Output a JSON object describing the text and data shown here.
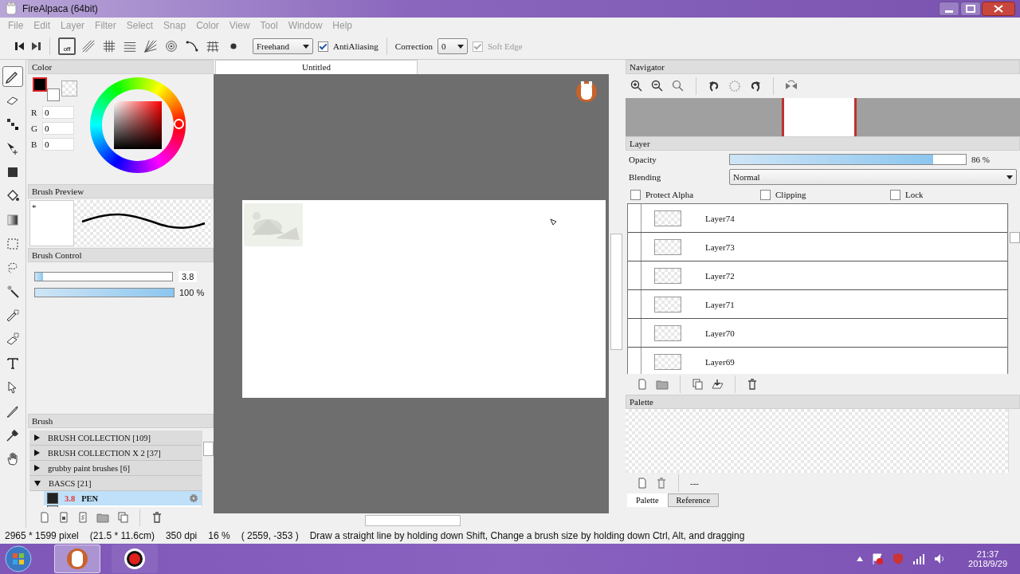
{
  "window": {
    "title": "FireAlpaca (64bit)"
  },
  "menu": [
    "File",
    "Edit",
    "Layer",
    "Filter",
    "Select",
    "Snap",
    "Color",
    "View",
    "Tool",
    "Window",
    "Help"
  ],
  "toolbar": {
    "snap_modes": [
      {
        "kind": "off",
        "label": "off",
        "selected": true
      },
      {
        "kind": "parallel",
        "selected": false
      },
      {
        "kind": "grid",
        "selected": false
      },
      {
        "kind": "horizontal",
        "selected": false
      },
      {
        "kind": "radial",
        "selected": false
      },
      {
        "kind": "circle",
        "selected": false
      },
      {
        "kind": "curve",
        "selected": false
      },
      {
        "kind": "perspective",
        "selected": false
      },
      {
        "kind": "dot",
        "selected": false
      }
    ],
    "stroke_mode": "Freehand",
    "antialiasing": {
      "label": "AntiAliasing",
      "checked": true
    },
    "correction": {
      "label": "Correction",
      "value": "0"
    },
    "soft_edge": {
      "label": "Soft Edge",
      "checked": true,
      "disabled": true
    }
  },
  "tools": [
    {
      "kind": "pen",
      "selected": true
    },
    {
      "kind": "eraser",
      "selected": false
    },
    {
      "kind": "dot",
      "selected": false
    },
    {
      "kind": "move",
      "selected": false
    },
    {
      "kind": "fill",
      "selected": false
    },
    {
      "kind": "bucket",
      "selected": false
    },
    {
      "kind": "gradient",
      "selected": false
    },
    {
      "kind": "select",
      "selected": false
    },
    {
      "kind": "lasso",
      "selected": false
    },
    {
      "kind": "wand",
      "selected": false
    },
    {
      "kind": "selpen",
      "selected": false
    },
    {
      "kind": "seleraser",
      "selected": false
    },
    {
      "kind": "text",
      "selected": false
    },
    {
      "kind": "operation",
      "selected": false
    },
    {
      "kind": "knife",
      "selected": false
    },
    {
      "kind": "dropper",
      "selected": false
    },
    {
      "kind": "hand",
      "selected": false
    }
  ],
  "color_panel": {
    "title": "Color",
    "channels": [
      {
        "label": "R",
        "value": "0"
      },
      {
        "label": "G",
        "value": "0"
      },
      {
        "label": "B",
        "value": "0"
      }
    ]
  },
  "brush_preview": {
    "title": "Brush Preview",
    "mark": "*"
  },
  "brush_control": {
    "title": "Brush Control",
    "size": {
      "level": 0.06,
      "reading": "3.8"
    },
    "opacity": {
      "level": 1,
      "reading": "100 %"
    }
  },
  "brush": {
    "title": "Brush",
    "groups": [
      {
        "label": "BRUSH COLLECTION [109]",
        "expanded": false
      },
      {
        "label": "BRUSH COLLECTION X 2 [37]",
        "expanded": false
      },
      {
        "label": "grubby paint brushes  [6]",
        "expanded": false
      },
      {
        "label": "BASCS [21]",
        "expanded": true
      }
    ],
    "items": [
      {
        "size": "3.8",
        "name": "PEN",
        "color": "#222222",
        "selected": true
      }
    ]
  },
  "canvas": {
    "tab": "Untitled"
  },
  "navigator": {
    "title": "Navigator"
  },
  "layer": {
    "title": "Layer",
    "opacity": {
      "label": "Opacity",
      "level": 0.86,
      "reading": "86 %"
    },
    "blending": {
      "label": "Blending",
      "value": "Normal"
    },
    "options": [
      {
        "label": "Protect Alpha",
        "checked": false
      },
      {
        "label": "Clipping",
        "checked": false
      },
      {
        "label": "Lock",
        "checked": false
      }
    ],
    "layers": [
      {
        "name": "Layer74",
        "selected": false
      },
      {
        "name": "Layer73",
        "selected": false
      },
      {
        "name": "Layer72",
        "selected": false
      },
      {
        "name": "Layer71",
        "selected": false
      },
      {
        "name": "Layer70",
        "selected": false
      },
      {
        "name": "Layer69",
        "selected": false
      }
    ]
  },
  "palette": {
    "title": "Palette",
    "status": "---",
    "tabs": [
      {
        "label": "Palette",
        "selected": true
      },
      {
        "label": "Reference",
        "selected": false
      }
    ]
  },
  "status_bar": [
    "2965 * 1599 pixel",
    "(21.5 * 11.6cm)",
    "350 dpi",
    "16 %",
    "( 2559, -353 )",
    "Draw a straight line by holding down Shift, Change a brush size by holding down Ctrl, Alt, and dragging"
  ],
  "taskbar": {
    "time": "21:37",
    "date": "2018/9/29"
  }
}
